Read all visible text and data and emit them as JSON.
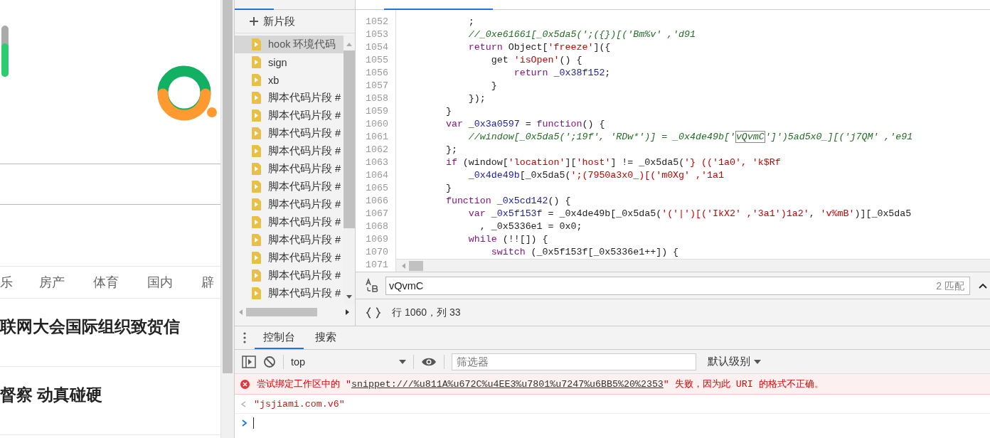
{
  "web_page": {
    "nav": [
      "乐",
      "房产",
      "体育",
      "国内",
      "辟"
    ],
    "headlines": [
      "联网大会国际组织致贺信",
      "督察 动真碰硬"
    ]
  },
  "snippets": {
    "new_button": "新片段",
    "items": [
      {
        "label": "hook 环境代码",
        "selected": true
      },
      {
        "label": "sign",
        "selected": false
      },
      {
        "label": "xb",
        "selected": false
      },
      {
        "label": "脚本代码片段 #",
        "selected": false
      },
      {
        "label": "脚本代码片段 #",
        "selected": false
      },
      {
        "label": "脚本代码片段 #",
        "selected": false
      },
      {
        "label": "脚本代码片段 #",
        "selected": false
      },
      {
        "label": "脚本代码片段 #",
        "selected": false
      },
      {
        "label": "脚本代码片段 #",
        "selected": false
      },
      {
        "label": "脚本代码片段 #",
        "selected": false
      },
      {
        "label": "脚本代码片段 #",
        "selected": false
      },
      {
        "label": "脚本代码片段 #",
        "selected": false
      },
      {
        "label": "脚本代码片段 #",
        "selected": false
      },
      {
        "label": "脚本代码片段 #",
        "selected": false
      },
      {
        "label": "脚本代码片段 #",
        "selected": false
      }
    ]
  },
  "editor": {
    "lines": [
      {
        "number": "1052",
        "tokens": [
          {
            "kind": "plain",
            "text": "        ;"
          }
        ]
      },
      {
        "number": "1053",
        "tokens": [
          {
            "kind": "comment",
            "text": "        //_0xe61661[_0x5da5(';({})[('Bm%v' ,'d91"
          }
        ]
      },
      {
        "number": "1054",
        "tokens": [
          {
            "kind": "keyword",
            "text": "        return"
          },
          {
            "kind": "plain",
            "text": " Object["
          },
          {
            "kind": "string",
            "text": "'freeze'"
          },
          {
            "kind": "plain",
            "text": "]({"
          }
        ]
      },
      {
        "number": "1055",
        "tokens": [
          {
            "kind": "plain",
            "text": "            get "
          },
          {
            "kind": "string",
            "text": "'isOpen'"
          },
          {
            "kind": "plain",
            "text": "() {"
          }
        ]
      },
      {
        "number": "1056",
        "tokens": [
          {
            "kind": "keyword",
            "text": "                return"
          },
          {
            "kind": "ident",
            "text": " _0x38f152"
          },
          {
            "kind": "plain",
            "text": ";"
          }
        ]
      },
      {
        "number": "1057",
        "tokens": [
          {
            "kind": "plain",
            "text": "            }"
          }
        ]
      },
      {
        "number": "1058",
        "tokens": [
          {
            "kind": "plain",
            "text": "        });"
          }
        ]
      },
      {
        "number": "1059",
        "tokens": [
          {
            "kind": "plain",
            "text": "    }"
          }
        ]
      },
      {
        "number": "1060",
        "tokens": [
          {
            "kind": "keyword",
            "text": "    var"
          },
          {
            "kind": "ident",
            "text": " _0x3a0597"
          },
          {
            "kind": "plain",
            "text": " = "
          },
          {
            "kind": "keyword",
            "text": "function"
          },
          {
            "kind": "plain",
            "text": "() {"
          }
        ]
      },
      {
        "number": "1061",
        "tokens": [
          {
            "kind": "comment",
            "text": "        //window[_0x5da5(';19f', 'RDw*')] = _0x4de49b['"
          },
          {
            "kind": "match",
            "text": "vQvmC"
          },
          {
            "kind": "comment",
            "text": "']')5ad5x0_][('j7QM' ,'e91"
          }
        ]
      },
      {
        "number": "1062",
        "tokens": [
          {
            "kind": "plain",
            "text": "    };"
          }
        ]
      },
      {
        "number": "1063",
        "tokens": [
          {
            "kind": "keyword",
            "text": "    if"
          },
          {
            "kind": "plain",
            "text": " (window["
          },
          {
            "kind": "string",
            "text": "'location'"
          },
          {
            "kind": "plain",
            "text": "]["
          },
          {
            "kind": "string",
            "text": "'host'"
          },
          {
            "kind": "plain",
            "text": "] != _0x5da5("
          },
          {
            "kind": "string",
            "text": "'} (('1a0', 'k$Rf"
          }
        ]
      },
      {
        "number": "1064",
        "tokens": [
          {
            "kind": "ident",
            "text": "        _0x4de49b"
          },
          {
            "kind": "plain",
            "text": "[_0x5da5("
          },
          {
            "kind": "string",
            "text": "';(7950a3x0_)[('m0Xg' ,'1a1"
          }
        ]
      },
      {
        "number": "1065",
        "tokens": [
          {
            "kind": "plain",
            "text": "    }"
          }
        ]
      },
      {
        "number": "1066",
        "tokens": [
          {
            "kind": "keyword",
            "text": "    function"
          },
          {
            "kind": "ident",
            "text": " _0x5cd142"
          },
          {
            "kind": "plain",
            "text": "() {"
          }
        ]
      },
      {
        "number": "1067",
        "tokens": [
          {
            "kind": "keyword",
            "text": "        var"
          },
          {
            "kind": "ident",
            "text": " _0x5f153f"
          },
          {
            "kind": "plain",
            "text": " = _0x4de49b[_0x5da5("
          },
          {
            "kind": "string",
            "text": "'('|')[('IkX2' ,'3a1')1a2'"
          },
          {
            "kind": "plain",
            "text": ", "
          },
          {
            "kind": "string",
            "text": "'v%mB'"
          },
          {
            "kind": "plain",
            "text": ")][_0x5da5"
          }
        ]
      },
      {
        "number": "1068",
        "tokens": [
          {
            "kind": "plain",
            "text": "          , _0x5336e1 = 0x0;"
          }
        ]
      },
      {
        "number": "1069",
        "tokens": [
          {
            "kind": "keyword",
            "text": "        while"
          },
          {
            "kind": "plain",
            "text": " (!![]) {"
          }
        ]
      },
      {
        "number": "1070",
        "tokens": [
          {
            "kind": "keyword",
            "text": "            switch"
          },
          {
            "kind": "plain",
            "text": " (_0x5f153f[_0x5336e1++]) {"
          }
        ]
      },
      {
        "number": "1071"
      }
    ]
  },
  "find_bar": {
    "value": "vQvmC",
    "count": "2 匹配"
  },
  "status": {
    "position": "行 1060，列 33"
  },
  "drawer": {
    "tabs": [
      {
        "label": "控制台",
        "selected": true
      },
      {
        "label": "搜索",
        "selected": false
      }
    ],
    "context": "top",
    "filter_placeholder": "筛选器",
    "level_menu": "默认级别",
    "messages": [
      {
        "kind": "error",
        "before": "尝试绑定工作区中的 \"",
        "link": "snippet:///%u811A%u672C%u4EE3%u7801%u7247%u6BB5%20%2353",
        "after": "\" 失败，因为此 URI 的格式不正确。"
      },
      {
        "kind": "result",
        "text": "\"jsjiami.com.v6\""
      }
    ]
  }
}
